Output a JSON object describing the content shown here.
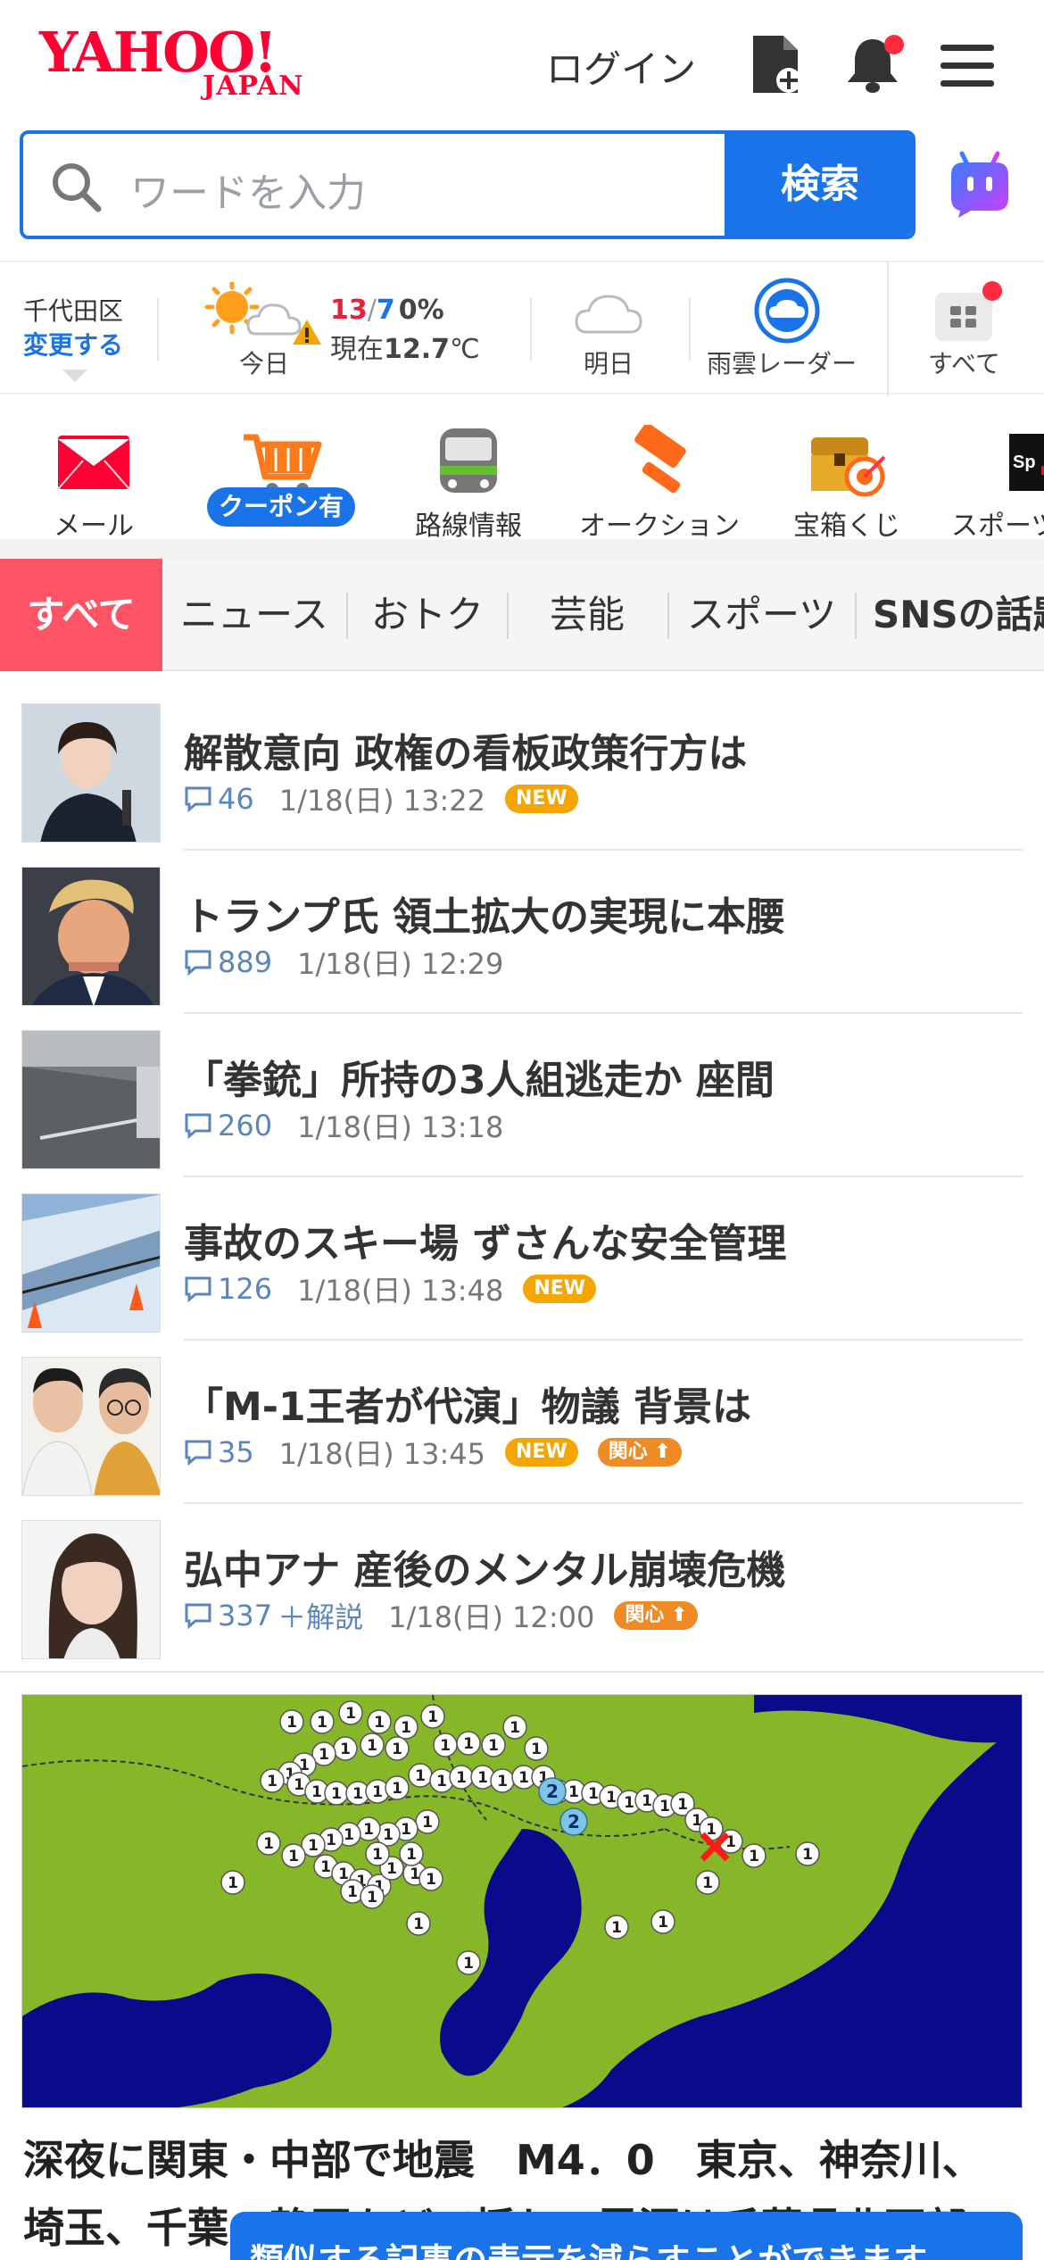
{
  "header": {
    "logo_main": "YAHOO!",
    "logo_sub": "JAPAN",
    "login_label": "ログイン",
    "icons": [
      "add-document-icon",
      "bell-icon",
      "menu-icon"
    ]
  },
  "search": {
    "placeholder": "ワードを入力",
    "button_label": "検索"
  },
  "weather": {
    "location": "千代田区",
    "change_label": "変更する",
    "today_label": "今日",
    "high": "13",
    "slash": "/",
    "low": "7",
    "precip": "0%",
    "now_prefix": "現在",
    "now_value": "12.7",
    "unit": "℃",
    "tomorrow_label": "明日",
    "radar_label": "雨雲レーダー",
    "all_label": "すべて"
  },
  "services": [
    {
      "label": "メール",
      "icon": "mail-icon"
    },
    {
      "label": "クーポン有",
      "icon": "shopping-cart-icon"
    },
    {
      "label": "路線情報",
      "icon": "train-icon"
    },
    {
      "label": "オークション",
      "icon": "auction-hammer-icon"
    },
    {
      "label": "宝箱くじ",
      "icon": "treasure-box-icon"
    },
    {
      "label": "スポーツ",
      "icon": "sports-icon"
    }
  ],
  "tabs": [
    "すべて",
    "ニュース",
    "おトク",
    "芸能",
    "スポーツ",
    "SNSの話題"
  ],
  "articles": [
    {
      "title": "解散意向 政権の看板政策行方は",
      "comments": "46",
      "time": "1/18(日) 13:22",
      "badge": "NEW"
    },
    {
      "title": "トランプ氏 領土拡大の実現に本腰",
      "comments": "889",
      "time": "1/18(日) 12:29",
      "badge": ""
    },
    {
      "title": "「拳銃」所持の3人組逃走か 座間",
      "comments": "260",
      "time": "1/18(日) 13:18",
      "badge": ""
    },
    {
      "title": "事故のスキー場 ずさんな安全管理",
      "comments": "126",
      "time": "1/18(日) 13:48",
      "badge": "NEW"
    },
    {
      "title": "「M-1王者が代演」物議 背景は",
      "comments": "35",
      "time": "1/18(日) 13:45",
      "badge": "NEW",
      "badge2": "関心"
    },
    {
      "title": "弘中アナ 産後のメンタル崩壊危機",
      "comments": "337",
      "extra": "＋解説",
      "time": "1/18(日) 12:00",
      "badge2": "関心"
    }
  ],
  "feature": {
    "headline": "深夜に関東・中部で地震　M4．0　東京、神奈川、埼玉、千葉、静岡などで揺れ　震源は千葉県北西部",
    "map_labels": [
      "1",
      "2"
    ]
  },
  "toast": {
    "text": "類似する記事の表示を減らすことができます"
  }
}
